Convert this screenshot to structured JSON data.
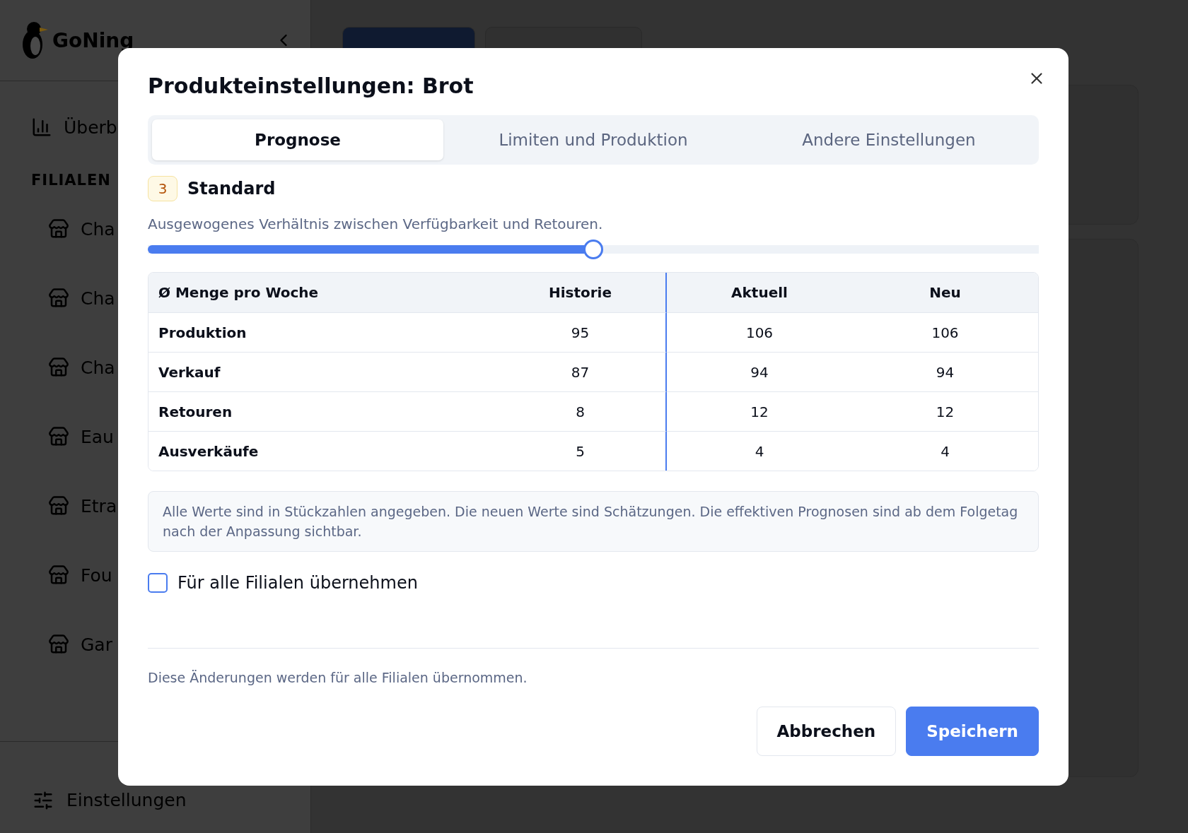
{
  "sidebar": {
    "brand": "GoNing",
    "overview": "Überb",
    "section": "FILIALEN",
    "branches": [
      "Cha",
      "Cha",
      "Cha",
      "Eau",
      "Etra",
      "Fou",
      "Gar"
    ],
    "settings": "Einstellungen"
  },
  "dialog": {
    "title": "Produkteinstellungen: Brot",
    "tabs": [
      {
        "label": "Prognose",
        "selected": true
      },
      {
        "label": "Limiten und Produktion",
        "selected": false
      },
      {
        "label": "Andere Einstellungen",
        "selected": false
      }
    ],
    "level_badge": "3",
    "level_name": "Standard",
    "description": "Ausgewogenes Verhältnis zwischen Verfügbarkeit und Retouren.",
    "slider": {
      "level": 0.5
    },
    "table": {
      "columns": [
        "Ø Menge pro Woche",
        "Historie",
        "Aktuell",
        "Neu"
      ],
      "rows": [
        {
          "label": "Produktion",
          "values": [
            "95",
            "106",
            "106"
          ]
        },
        {
          "label": "Verkauf",
          "values": [
            "87",
            "94",
            "94"
          ]
        },
        {
          "label": "Retouren",
          "values": [
            "8",
            "12",
            "12"
          ]
        },
        {
          "label": "Ausverkäufe",
          "values": [
            "5",
            "4",
            "4"
          ]
        }
      ]
    },
    "note": "Alle Werte sind in Stückzahlen angegeben. Die neuen Werte sind Schätzungen. Die effektiven Prognosen sind ab dem Folgetag nach der Anpassung sichtbar.",
    "apply_all": {
      "label": "Für alle Filialen übernehmen",
      "checked": false
    },
    "footer_note": "Diese Änderungen werden für alle Filialen übernommen.",
    "buttons": [
      {
        "label": "Abbrechen",
        "kind": "secondary"
      },
      {
        "label": "Speichern",
        "kind": "primary"
      }
    ]
  }
}
